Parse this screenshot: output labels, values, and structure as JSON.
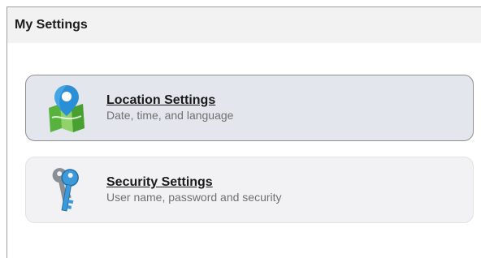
{
  "header": {
    "title": "My Settings"
  },
  "items": [
    {
      "title": "Location Settings",
      "subtitle": "Date, time, and language",
      "icon": "map-pin-icon",
      "state": "selected"
    },
    {
      "title": "Security Settings",
      "subtitle": "User name, password and security",
      "icon": "keys-icon",
      "state": "default"
    }
  ],
  "colors": {
    "header_bg": "#f2f2f2",
    "selected_card_bg": "#e3e6ec",
    "card_bg": "#f2f2f4",
    "pin_blue": "#2b8fd6",
    "map_green": "#57b33d"
  }
}
